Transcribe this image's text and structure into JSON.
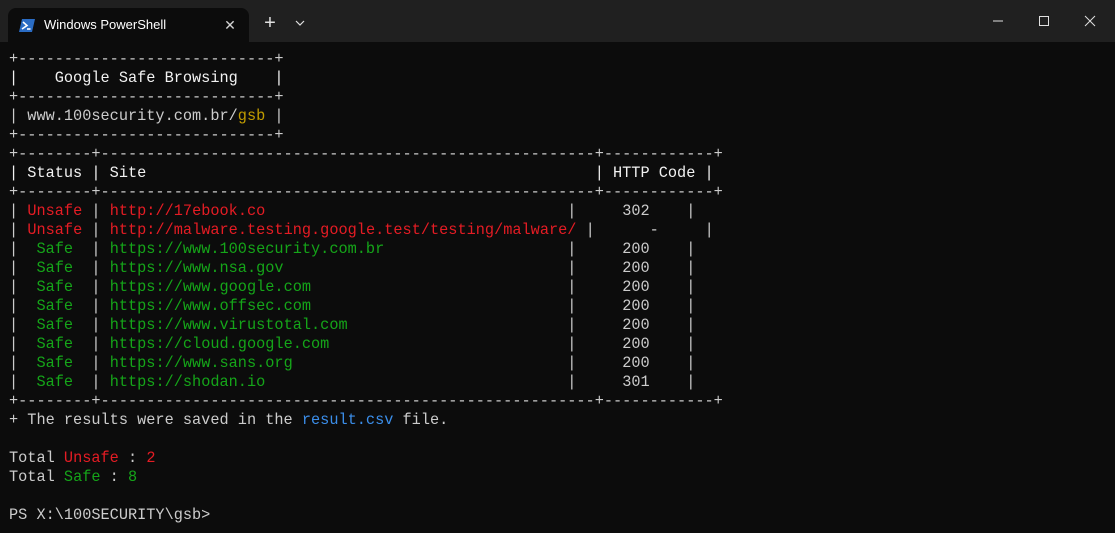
{
  "tab": {
    "title": "Windows PowerShell",
    "icon": "powershell-icon"
  },
  "window_controls": {
    "minimize": "minimize-icon",
    "maximize": "maximize-icon",
    "close": "close-icon"
  },
  "colors": {
    "unsafe": "#e51c24",
    "safe": "#15a519",
    "highlight": "#c19c00",
    "file": "#3b8eea",
    "text": "#cccccc"
  },
  "banner": {
    "border_top": "+----------------------------+",
    "title_line": "|    Google Safe Browsing    |",
    "border_mid": "+----------------------------+",
    "url_prefix": "| www.100security.com.br/",
    "url_highlight": "gsb",
    "url_suffix": " |",
    "border_bottom": "+----------------------------+"
  },
  "table": {
    "border_top": "+--------+------------------------------------------------------+------------+",
    "header_line": "| Status | Site                                                 | HTTP Code |",
    "border_header": "+--------+------------------------------------------------------+------------+",
    "rows": [
      {
        "pre": "| ",
        "status": "Unsafe",
        "mid": " | ",
        "site": "http://17ebook.co                                ",
        "code": "    302    |",
        "safe": false
      },
      {
        "pre": "| ",
        "status": "Unsafe",
        "mid": " | ",
        "site": "http://malware.testing.google.test/testing/malware/",
        "code": "     -     |",
        "safe": false
      },
      {
        "pre": "|  ",
        "status": "Safe",
        "mid": "  | ",
        "site": "https://www.100security.com.br                   ",
        "code": "    200    |",
        "safe": true
      },
      {
        "pre": "|  ",
        "status": "Safe",
        "mid": "  | ",
        "site": "https://www.nsa.gov                              ",
        "code": "    200    |",
        "safe": true
      },
      {
        "pre": "|  ",
        "status": "Safe",
        "mid": "  | ",
        "site": "https://www.google.com                           ",
        "code": "    200    |",
        "safe": true
      },
      {
        "pre": "|  ",
        "status": "Safe",
        "mid": "  | ",
        "site": "https://www.offsec.com                           ",
        "code": "    200    |",
        "safe": true
      },
      {
        "pre": "|  ",
        "status": "Safe",
        "mid": "  | ",
        "site": "https://www.virustotal.com                       ",
        "code": "    200    |",
        "safe": true
      },
      {
        "pre": "|  ",
        "status": "Safe",
        "mid": "  | ",
        "site": "https://cloud.google.com                         ",
        "code": "    200    |",
        "safe": true
      },
      {
        "pre": "|  ",
        "status": "Safe",
        "mid": "  | ",
        "site": "https://www.sans.org                             ",
        "code": "    200    |",
        "safe": true
      },
      {
        "pre": "|  ",
        "status": "Safe",
        "mid": "  | ",
        "site": "https://shodan.io                                ",
        "code": "    301    |",
        "safe": true
      }
    ],
    "border_bottom": "+--------+------------------------------------------------------+------------+"
  },
  "saved": {
    "prefix": "+ The results were saved in the ",
    "file": "result.csv",
    "suffix": " file."
  },
  "totals": {
    "unsafe_label": "Total ",
    "unsafe_word": "Unsafe",
    "unsafe_sep": " : ",
    "unsafe_count": "2",
    "safe_label": "Total ",
    "safe_word": "Safe",
    "safe_sep": " : ",
    "safe_count": "8"
  },
  "prompt": "PS X:\\100SECURITY\\gsb>"
}
